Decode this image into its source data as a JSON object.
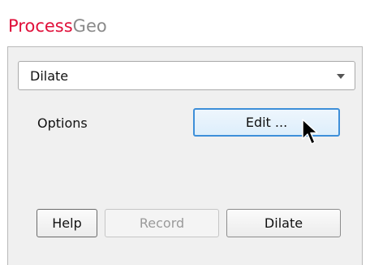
{
  "app": {
    "title_part1": "Process",
    "title_part2": "Geo"
  },
  "operation_select": {
    "value": "Dilate"
  },
  "options": {
    "label": "Options",
    "edit_button": "Edit ..."
  },
  "footer": {
    "help_button": "Help",
    "record_button": "Record",
    "run_button": "Dilate"
  },
  "colors": {
    "brand_red": "#e0103a",
    "brand_gray": "#8a8a8a",
    "focus_blue": "#3e8fd9"
  },
  "icons": {
    "dropdown": "chevron-down-icon",
    "pointer": "mouse-cursor-icon"
  }
}
